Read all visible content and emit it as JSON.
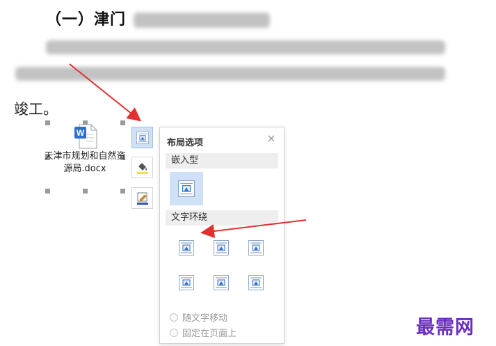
{
  "document": {
    "heading_visible": "（一）津门",
    "last_line": "竣工。"
  },
  "attachment": {
    "icon": "word-docx-icon",
    "icon_letter": "W",
    "file_name": "天津市规划和自然资源局.docx"
  },
  "side_toolbar": [
    {
      "name": "layout-options-icon",
      "active": true
    },
    {
      "name": "fill-bucket-icon",
      "active": false
    },
    {
      "name": "pen-outline-icon",
      "active": false
    }
  ],
  "layout_panel": {
    "title": "布局选项",
    "close_icon": "×",
    "inline_section": "嵌入型",
    "wrap_section": "文字环绕",
    "options": {
      "move_with_text": "随文字移动",
      "fix_on_page": "固定在页面上"
    }
  },
  "watermark": "最需网",
  "colors": {
    "arrow": "#e03030",
    "accent": "#2f6fcf",
    "selected_bg": "#cfe0f7",
    "watermark": "#6b2fc0"
  }
}
